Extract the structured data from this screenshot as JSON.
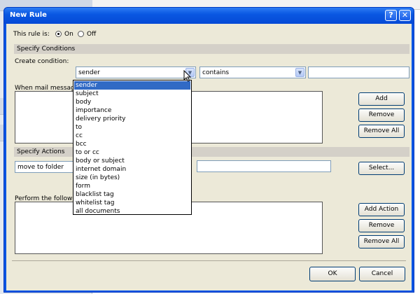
{
  "dialog": {
    "title": "New Rule",
    "help_label": "?",
    "close_label": "✕"
  },
  "rule_state": {
    "label": "This rule is:",
    "on_label": "On",
    "off_label": "Off",
    "selected": "On"
  },
  "conditions": {
    "section_title": "Specify Conditions",
    "create_label": "Create condition:",
    "field_combo_value": "sender",
    "operator_combo_value": "contains",
    "value_input": "",
    "when_label": "When mail message",
    "add_label": "Add",
    "remove_label": "Remove",
    "remove_all_label": "Remove All"
  },
  "dropdown": {
    "items": [
      "sender",
      "subject",
      "body",
      "importance",
      "delivery priority",
      "to",
      "cc",
      "bcc",
      "to or cc",
      "body or subject",
      "internet domain",
      "size (in bytes)",
      "form",
      "blacklist tag",
      "whitelist tag",
      "all documents"
    ],
    "selected_index": 0
  },
  "actions": {
    "section_title": "Specify Actions",
    "action_combo_value": "move to folder",
    "folder_input": "",
    "select_label": "Select...",
    "perform_label": "Perform the followi",
    "add_action_label": "Add Action",
    "remove_label": "Remove",
    "remove_all_label": "Remove All"
  },
  "footer": {
    "ok_label": "OK",
    "cancel_label": "Cancel"
  },
  "colors": {
    "titlebar": "#0a58e2",
    "dialog_bg": "#ece9d8",
    "selection": "#316ac5"
  }
}
